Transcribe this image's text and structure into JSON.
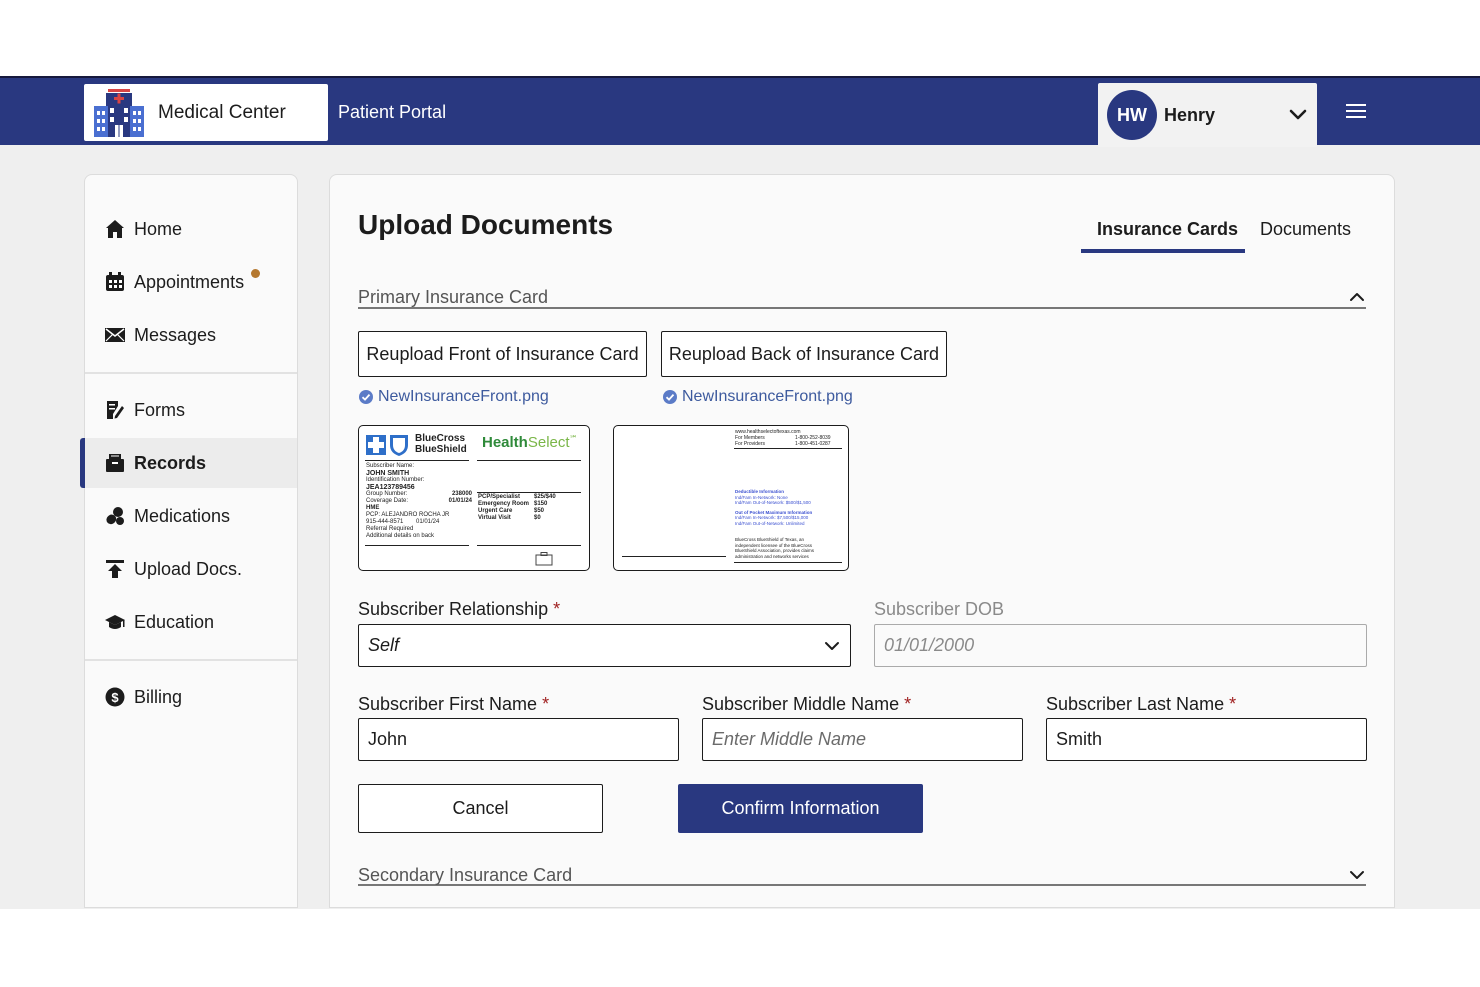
{
  "header": {
    "logo_text": "Medical Center",
    "portal_text": "Patient Portal",
    "user": {
      "initials": "HW",
      "name": "Henry"
    }
  },
  "sidebar": {
    "items": [
      {
        "label": "Home",
        "icon": "home-icon"
      },
      {
        "label": "Appointments",
        "icon": "calendar-icon",
        "notification": true
      },
      {
        "label": "Messages",
        "icon": "envelope-icon"
      },
      {
        "label": "Forms",
        "icon": "form-icon"
      },
      {
        "label": "Records",
        "icon": "folder-icon",
        "active": true
      },
      {
        "label": "Medications",
        "icon": "pills-icon"
      },
      {
        "label": "Upload Docs.",
        "icon": "upload-icon"
      },
      {
        "label": "Education",
        "icon": "graduation-cap-icon"
      },
      {
        "label": "Billing",
        "icon": "dollar-icon"
      }
    ]
  },
  "main": {
    "title": "Upload Documents",
    "tabs": [
      {
        "label": "Insurance Cards",
        "active": true
      },
      {
        "label": "Documents",
        "active": false
      }
    ],
    "primary": {
      "title": "Primary Insurance Card",
      "front_button": "Reupload Front of Insurance Card",
      "back_button": "Reupload Back of Insurance Card",
      "front_file": "NewInsuranceFront.png",
      "back_file": "NewInsuranceFront.png",
      "card_front": {
        "brand": "BlueCross BlueShield",
        "brand_line1": "BlueCross",
        "brand_line2": "BlueShield",
        "plan_a": "Health",
        "plan_b": "Select",
        "plan_mark": "℠",
        "subscriber_label": "Subscriber Name:",
        "subscriber_name": "JOHN SMITH",
        "id_label": "Identification Number:",
        "id_value": "JEA123789456",
        "group_label": "Group Number:",
        "group_value": "238000",
        "coverage_label": "Coverage Date:",
        "coverage_value": "01/01/24",
        "plan_code": "HME",
        "pcp": "PCP:  ALEJANDRO ROCHA JR",
        "pcp_phone": "915-444-8571",
        "pcp_date": "01/01/24",
        "referral": "Referral Required",
        "additional": "Additional details on back",
        "copays": [
          {
            "label": "PCP/Specialist",
            "value": "$25/$40"
          },
          {
            "label": "Emergency Room",
            "value": "$150"
          },
          {
            "label": "Urgent Care",
            "value": "$50"
          },
          {
            "label": "Virtual Visit",
            "value": "$0"
          }
        ]
      },
      "card_back": {
        "website": "www.healthselectoftexas.com",
        "for_members": "For Members",
        "members_phone": "1-800-252-8039",
        "for_providers": "For Providers",
        "providers_phone": "1-800-451-0287",
        "deductible_title": "Deductible Information",
        "deductible_lines": [
          "Ind/Fam In-Network: None",
          "Ind/Fam Out-of-Network: $500/$1,500"
        ],
        "oop_title": "Out of Pocket Maximum Information",
        "oop_lines": [
          "Ind/Fam In-Network: $7,500/$15,000",
          "Ind/Fam Out-of-Network: Unlimited"
        ],
        "footer_lines": [
          "BlueCross BlueShield of Texas, an",
          "independent licensee of the BlueCross",
          "BlueShield Association, provides claims",
          "administration and networks services"
        ]
      },
      "relationship_label": "Subscriber Relationship",
      "relationship_value": "Self",
      "dob_label": "Subscriber DOB",
      "dob_placeholder": "01/01/2000",
      "first_name_label": "Subscriber First Name",
      "first_name_value": "John",
      "middle_name_label": "Subscriber Middle Name",
      "middle_name_placeholder": "Enter Middle Name",
      "last_name_label": "Subscriber Last Name",
      "last_name_value": "Smith",
      "required_marker": "*",
      "cancel_label": "Cancel",
      "confirm_label": "Confirm Information"
    },
    "secondary": {
      "title": "Secondary Insurance Card"
    }
  },
  "colors": {
    "navy": "#293880",
    "notification_dot": "#b5782f",
    "required": "#a02121",
    "file_link": "#3d5a9e"
  }
}
